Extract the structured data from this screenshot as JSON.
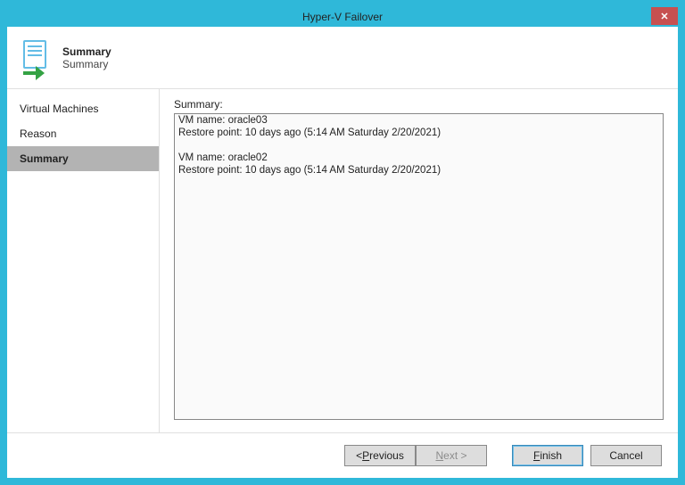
{
  "titlebar": {
    "title": "Hyper-V Failover",
    "close_label": "✕"
  },
  "header": {
    "title": "Summary",
    "subtitle": "Summary"
  },
  "sidebar": {
    "steps": [
      {
        "label": "Virtual Machines",
        "active": false
      },
      {
        "label": "Reason",
        "active": false
      },
      {
        "label": "Summary",
        "active": true
      }
    ]
  },
  "content": {
    "label": "Summary:",
    "entries": [
      {
        "vm_name_line": "VM name: oracle03",
        "restore_line": "Restore point: 10 days ago (5:14 AM Saturday 2/20/2021)"
      },
      {
        "vm_name_line": "VM name: oracle02",
        "restore_line": "Restore point: 10 days ago (5:14 AM Saturday 2/20/2021)"
      }
    ]
  },
  "footer": {
    "previous_pre": "< ",
    "previous_ul": "P",
    "previous_post": "revious",
    "next_ul": "N",
    "next_post": "ext >",
    "finish_ul": "F",
    "finish_post": "inish",
    "cancel": "Cancel"
  }
}
